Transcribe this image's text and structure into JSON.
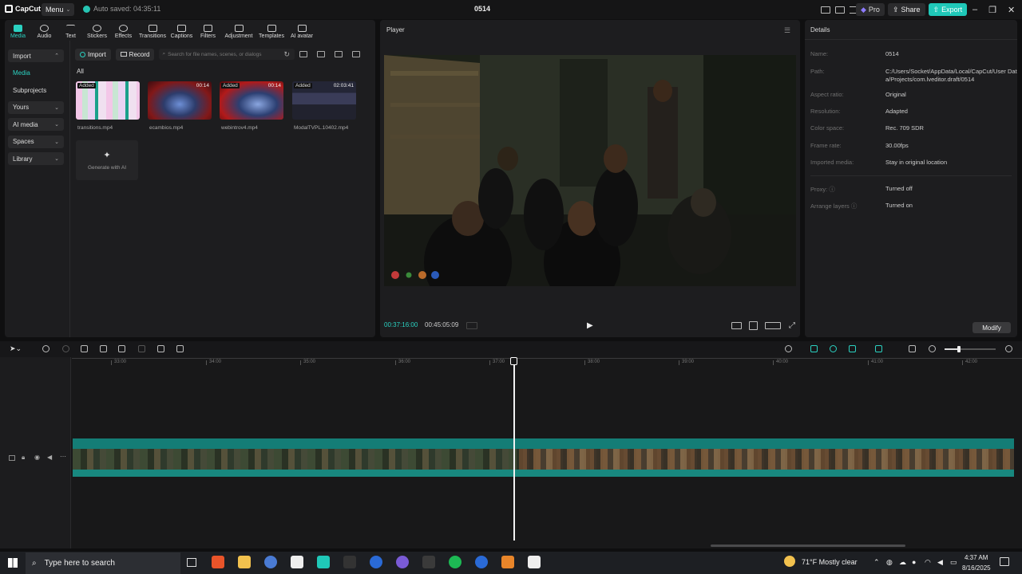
{
  "titlebar": {
    "logo": "CapCut",
    "menu_label": "Menu",
    "autosave": "Auto saved: 04:35:11",
    "project_title": "0514",
    "pro_label": "Pro",
    "share_label": "Share",
    "export_label": "Export"
  },
  "toolbar_tabs": [
    {
      "label": "Media",
      "icon": "media-icon"
    },
    {
      "label": "Audio",
      "icon": "audio-icon"
    },
    {
      "label": "Text",
      "icon": "text-icon"
    },
    {
      "label": "Stickers",
      "icon": "sticker-icon"
    },
    {
      "label": "Effects",
      "icon": "effects-icon"
    },
    {
      "label": "Transitions",
      "icon": "transitions-icon"
    },
    {
      "label": "Captions",
      "icon": "captions-icon"
    },
    {
      "label": "Filters",
      "icon": "filters-icon"
    },
    {
      "label": "Adjustment",
      "icon": "adjustment-icon"
    },
    {
      "label": "Templates",
      "icon": "templates-icon"
    },
    {
      "label": "AI avatar",
      "icon": "ai-avatar-icon"
    }
  ],
  "leftnav": {
    "import": "Import",
    "media": "Media",
    "subprojects": "Subprojects",
    "yours": "Yours",
    "ai_media": "AI media",
    "spaces": "Spaces",
    "library": "Library"
  },
  "media": {
    "import_btn": "Import",
    "record_btn": "Record",
    "search_placeholder": "Search for file names, scenes, or dialogs",
    "all_label": "All",
    "items": [
      {
        "name": "transitions.mp4",
        "badge": "Added",
        "duration": ""
      },
      {
        "name": "ecambios.mp4",
        "badge": "",
        "duration": "00:14"
      },
      {
        "name": "webintrov4.mp4",
        "badge": "Added",
        "duration": "00:14"
      },
      {
        "name": "ModalTVPL.10402.mp4",
        "badge": "Added",
        "duration": "02:03:41"
      }
    ],
    "generate_ai": "Generate with AI"
  },
  "player": {
    "title": "Player",
    "current_time": "00:37:16:00",
    "total_time": "00:45:05:09",
    "ratio_label": "Ratio"
  },
  "details": {
    "title": "Details",
    "rows": [
      {
        "k": "Name:",
        "v": "0514"
      },
      {
        "k": "Path:",
        "v": "C:/Users/Socket/AppData/Local/CapCut/User Data/Projects/com.lveditor.draft/0514"
      },
      {
        "k": "Aspect ratio:",
        "v": "Original"
      },
      {
        "k": "Resolution:",
        "v": "Adapted"
      },
      {
        "k": "Color space:",
        "v": "Rec. 709 SDR"
      },
      {
        "k": "Frame rate:",
        "v": "30.00fps"
      },
      {
        "k": "Imported media:",
        "v": "Stay in original location"
      },
      {
        "k": "Proxy:",
        "v": "Turned off"
      },
      {
        "k": "Arrange layers",
        "v": "Turned on"
      }
    ],
    "modify_label": "Modify"
  },
  "ruler": [
    "33:00",
    "34:00",
    "35:00",
    "36:00",
    "37:00",
    "38:00",
    "39:00",
    "40:00",
    "41:00",
    "42:00"
  ],
  "taskbar": {
    "search_placeholder": "Type here to search",
    "weather": "71°F  Mostly clear",
    "time": "4:37 AM",
    "date": "8/16/2025"
  },
  "colors": {
    "accent": "#2bd1c1",
    "track": "#147d76",
    "panel": "#1d1d1f"
  }
}
